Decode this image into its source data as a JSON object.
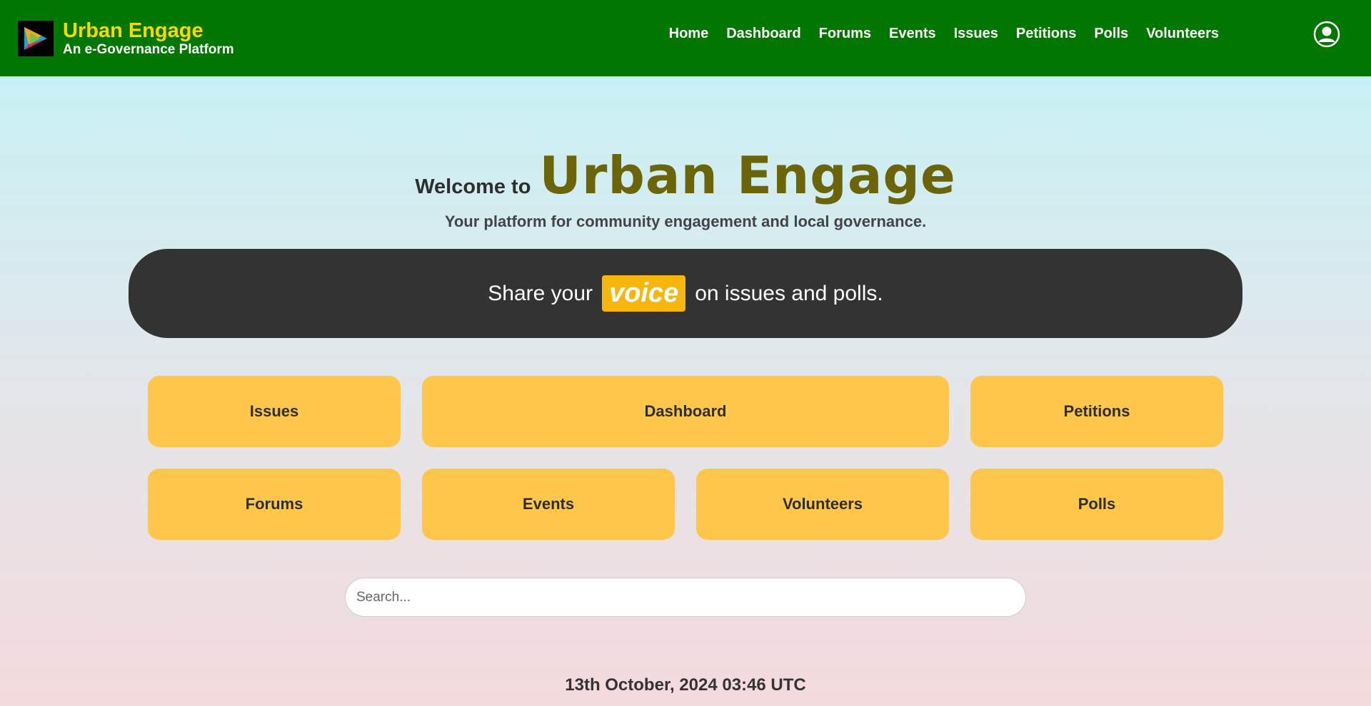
{
  "header": {
    "brand_title": "Urban Engage",
    "brand_subtitle": "An e-Governance Platform",
    "nav": [
      "Home",
      "Dashboard",
      "Forums",
      "Events",
      "Issues",
      "Petitions",
      "Polls",
      "Volunteers"
    ],
    "profile_icon": "user-circle-icon",
    "logo_icon": "play-logo-icon",
    "colors": {
      "bar": "#017600",
      "brand_title": "#ffd700"
    }
  },
  "hero": {
    "welcome_prefix": "Welcome to",
    "welcome_name": "Urban Engage",
    "tagline": "Your platform for community engagement and local governance."
  },
  "banner": {
    "before": "Share your",
    "highlight": "voice",
    "after": "on issues and polls."
  },
  "tiles": [
    "Issues",
    "Dashboard",
    "Petitions",
    "Forums",
    "Events",
    "Volunteers",
    "Polls"
  ],
  "search": {
    "placeholder": "Search...",
    "value": ""
  },
  "datetime": "13th October, 2024 03:46 UTC"
}
